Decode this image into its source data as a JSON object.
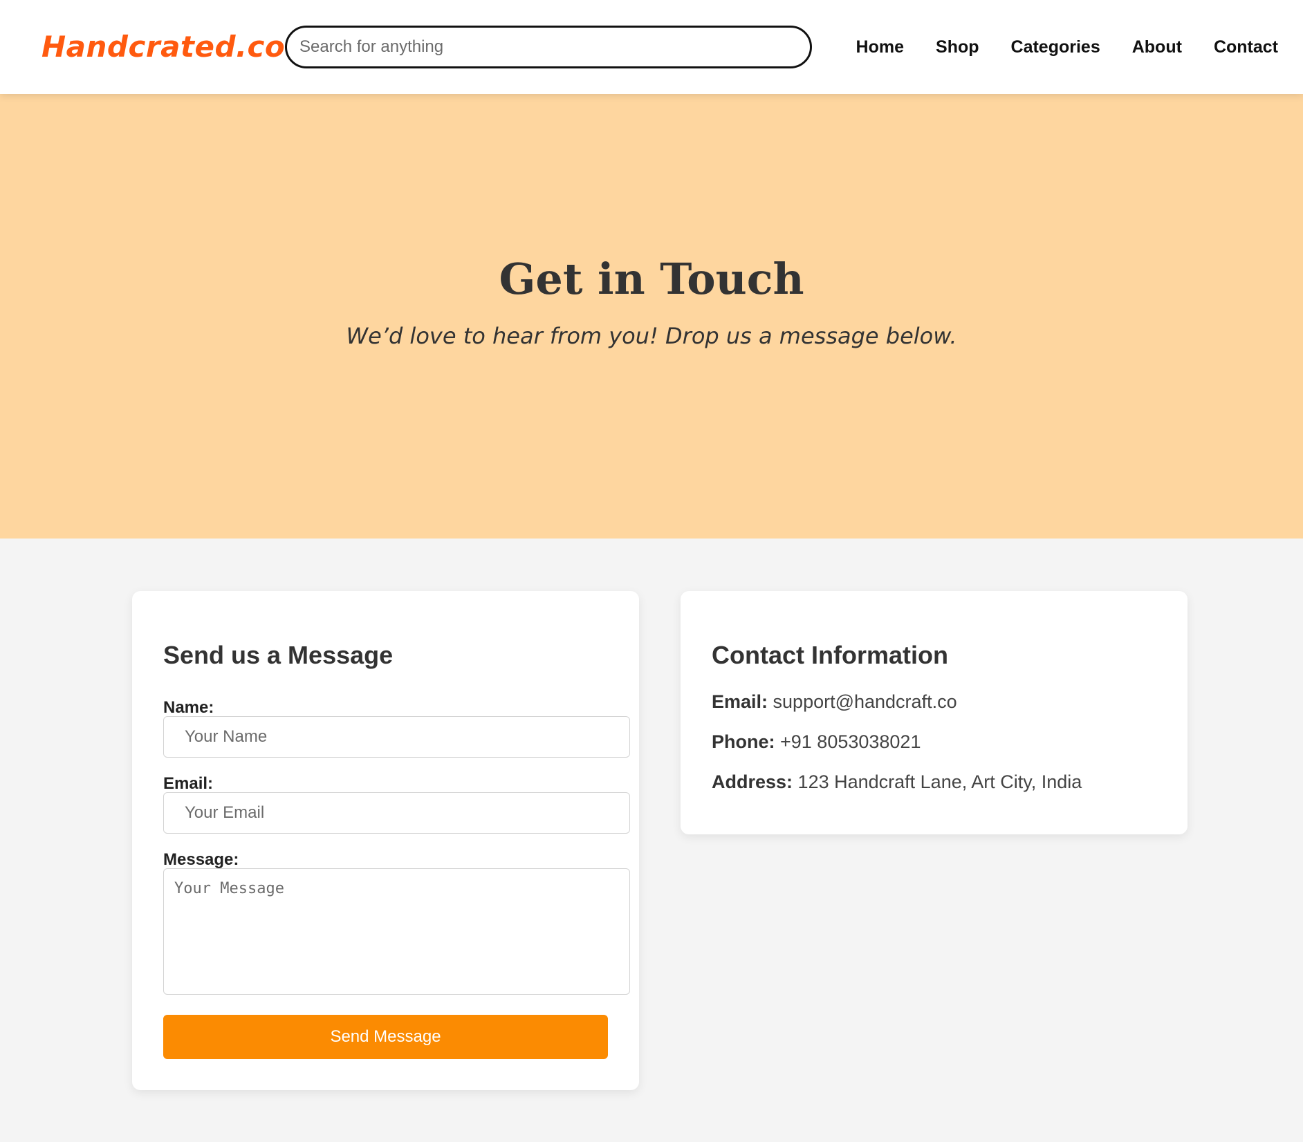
{
  "header": {
    "logo": "Handcrated.co",
    "search_placeholder": "Search for anything",
    "nav": [
      "Home",
      "Shop",
      "Categories",
      "About",
      "Contact"
    ],
    "logo_color": "#ff5a0f"
  },
  "hero": {
    "title": "Get in Touch",
    "subtitle": "We’d love to hear from you! Drop us a message below.",
    "background_color": "#fed69f"
  },
  "form": {
    "heading": "Send us a Message",
    "name_label": "Name:",
    "name_placeholder": "Your Name",
    "email_label": "Email:",
    "email_placeholder": "Your Email",
    "message_label": "Message:",
    "message_placeholder": "Your Message",
    "submit_label": "Send Message",
    "button_color": "#fb8b02"
  },
  "contact": {
    "heading": "Contact Information",
    "email_label": "Email:",
    "email_value": "support@handcraft.co",
    "phone_label": "Phone:",
    "phone_value": "+91 8053038021",
    "address_label": "Address:",
    "address_value": "123 Handcraft Lane, Art City, India"
  }
}
